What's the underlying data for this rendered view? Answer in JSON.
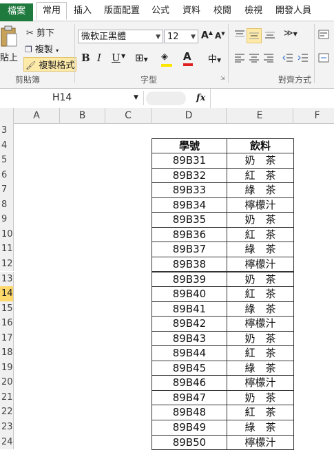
{
  "tabs": [
    "檔案",
    "常用",
    "插入",
    "版面配置",
    "公式",
    "資料",
    "校閱",
    "檢視",
    "開發人員"
  ],
  "clipboard": {
    "paste": "貼上",
    "cut": "剪下",
    "copy": "複製",
    "format_painter": "複製格式",
    "group": "剪貼簿"
  },
  "font": {
    "name": "微軟正黑體",
    "size": "12",
    "group": "字型",
    "bold": "B",
    "italic": "I",
    "underline": "U"
  },
  "alignment": {
    "group": "對齊方式"
  },
  "formula_bar": {
    "name_box": "H14",
    "fx": "fx"
  },
  "columns": [
    "A",
    "B",
    "C",
    "D",
    "E",
    "F"
  ],
  "rows": [
    "3",
    "4",
    "5",
    "6",
    "7",
    "8",
    "9",
    "10",
    "11",
    "12",
    "13",
    "14",
    "15",
    "16",
    "17",
    "18",
    "19",
    "20",
    "21",
    "22",
    "23",
    "24"
  ],
  "selected_row": "14",
  "table": {
    "headers": [
      "學號",
      "飲料"
    ],
    "rows": [
      [
        "89B31",
        "奶　茶"
      ],
      [
        "89B32",
        "紅　茶"
      ],
      [
        "89B33",
        "綠　茶"
      ],
      [
        "89B34",
        "檸檬汁"
      ],
      [
        "89B35",
        "奶　茶"
      ],
      [
        "89B36",
        "紅　茶"
      ],
      [
        "89B37",
        "綠　茶"
      ],
      [
        "89B38",
        "檸檬汁"
      ],
      [
        "89B39",
        "奶　茶"
      ],
      [
        "89B40",
        "紅　茶"
      ],
      [
        "89B41",
        "綠　茶"
      ],
      [
        "89B42",
        "檸檬汁"
      ],
      [
        "89B43",
        "奶　茶"
      ],
      [
        "89B44",
        "紅　茶"
      ],
      [
        "89B45",
        "綠　茶"
      ],
      [
        "89B46",
        "檸檬汁"
      ],
      [
        "89B47",
        "奶　茶"
      ],
      [
        "89B48",
        "紅　茶"
      ],
      [
        "89B49",
        "綠　茶"
      ],
      [
        "89B50",
        "檸檬汁"
      ]
    ]
  },
  "colors": {
    "file_tab": "#1f7a3d",
    "font_color": "#e02020",
    "highlight": "#ffe600",
    "selected_row": "#ffd86c"
  }
}
